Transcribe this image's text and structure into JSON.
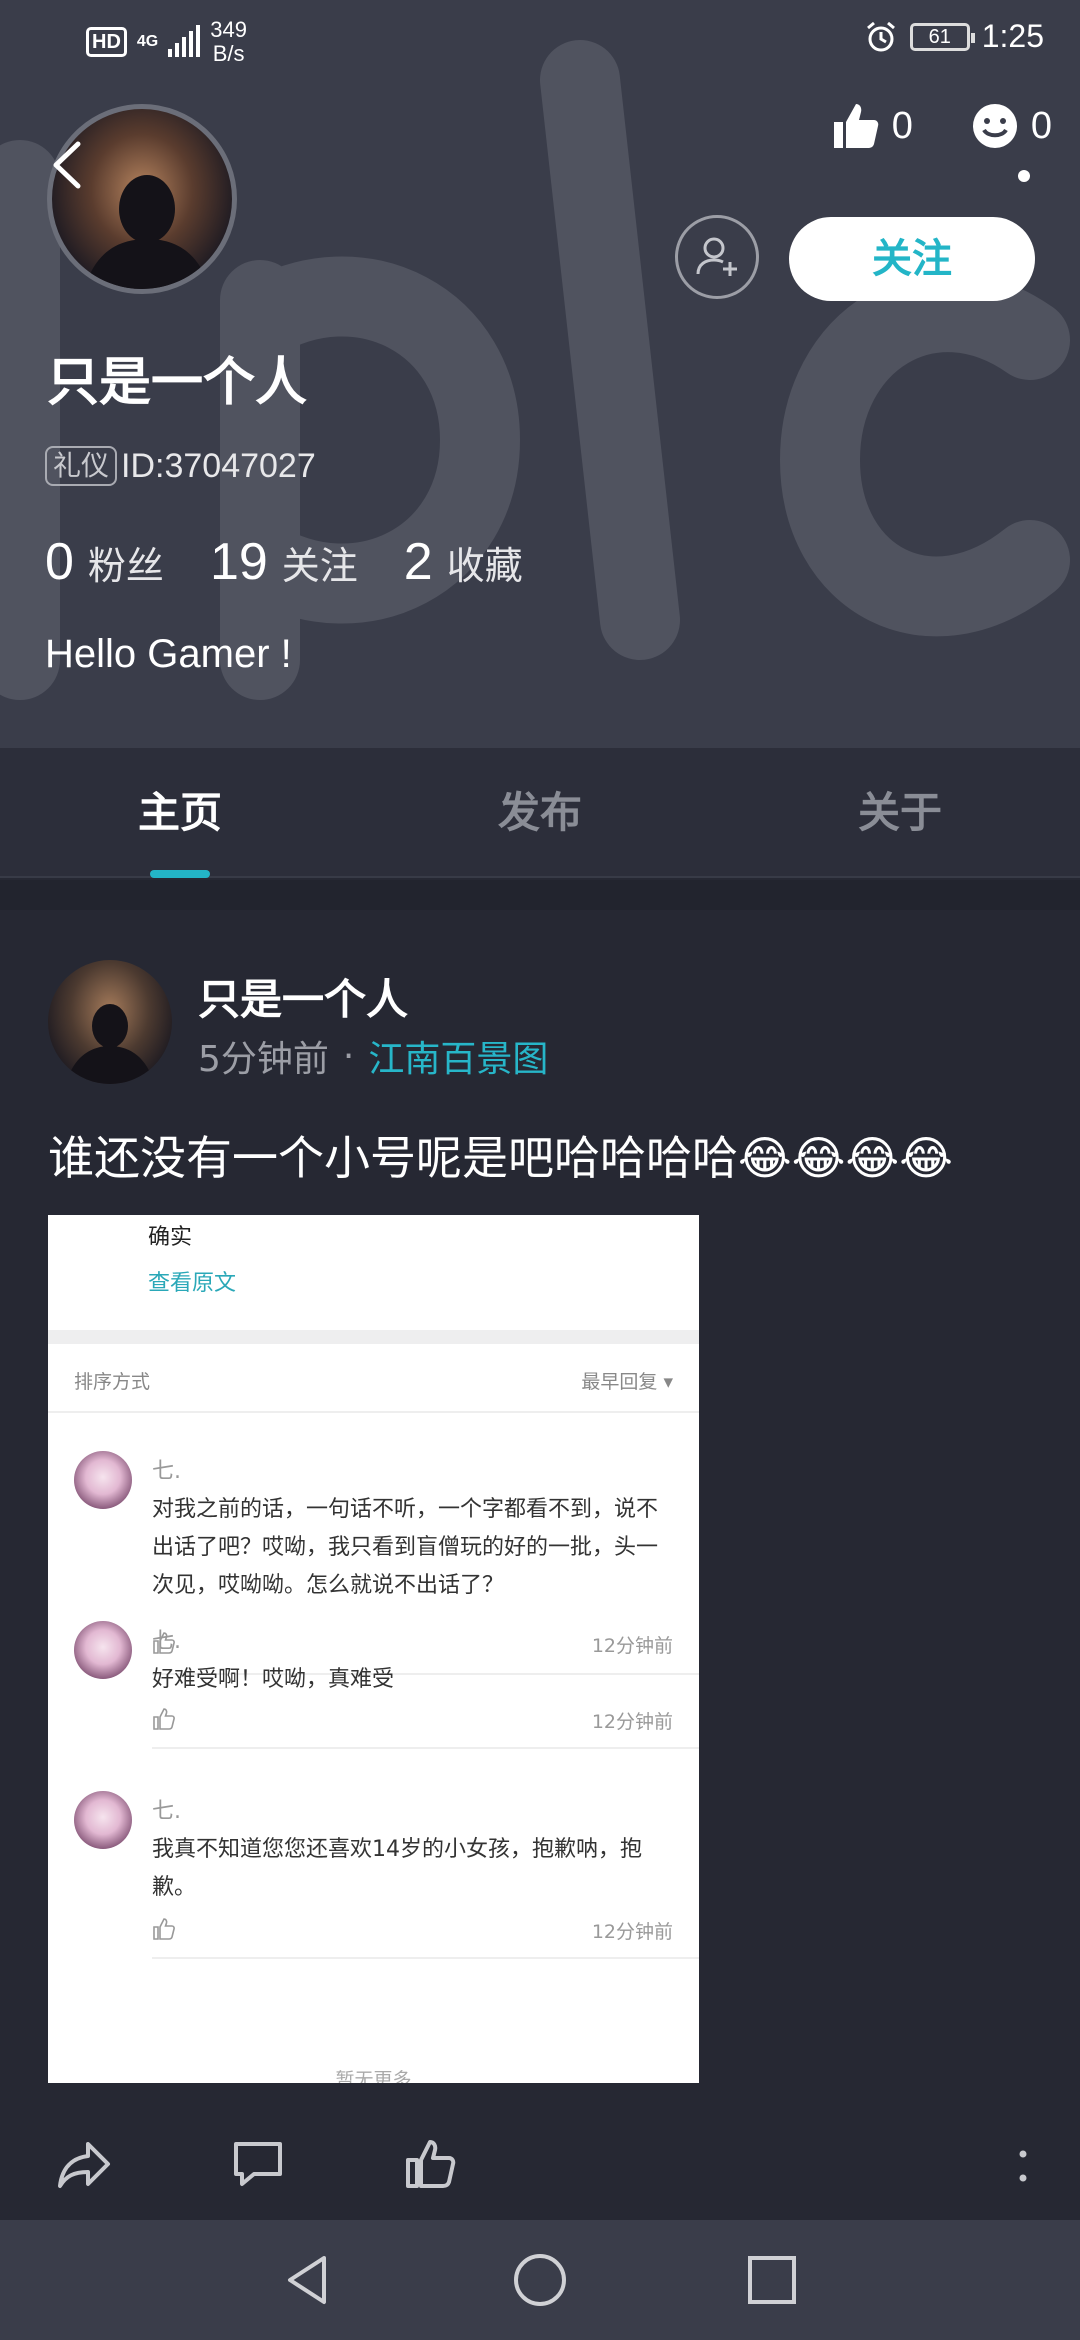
{
  "status_bar": {
    "hd": "HD",
    "network": "4G",
    "speed_value": "349",
    "speed_unit": "B/s",
    "battery": "61",
    "time": "1:25"
  },
  "profile": {
    "username": "只是一个人",
    "badge": "礼仪",
    "id_text": "ID:37047027",
    "likes_count": "0",
    "emoji_count": "0",
    "follow_label": "关注",
    "bio": "Hello Gamer !",
    "stats": [
      {
        "num": "0",
        "label": "粉丝"
      },
      {
        "num": "19",
        "label": "关注"
      },
      {
        "num": "2",
        "label": "收藏"
      }
    ]
  },
  "tabs": [
    {
      "label": "主页",
      "active": true
    },
    {
      "label": "发布",
      "active": false
    },
    {
      "label": "关于",
      "active": false
    }
  ],
  "post": {
    "author": "只是一个人",
    "time": "5分钟前",
    "separator": "·",
    "topic": "江南百景图",
    "text": "谁还没有一个小号呢是吧哈哈哈哈😂😂😂😂",
    "screenshot": {
      "top_text": "确实",
      "view_original": "查看原文",
      "sort_label": "排序方式",
      "sort_value": "最早回复",
      "comments": [
        {
          "name": "七.",
          "text": "对我之前的话，一句话不听，一个字都看不到，说不出话了吧？哎呦，我只看到盲僧玩的好的一批，头一次见，哎呦呦。怎么就说不出话了？",
          "time": "12分钟前"
        },
        {
          "name": "七.",
          "text": "好难受啊！哎呦，真难受",
          "time": "12分钟前"
        },
        {
          "name": "七.",
          "text": "我真不知道您您还喜欢14岁的小女孩，抱歉呐，抱歉。",
          "time": "12分钟前"
        }
      ],
      "more_text": "暂无更多"
    }
  },
  "colors": {
    "accent": "#23b5c7",
    "header_bg": "#3a3d4a",
    "page_bg": "#262833"
  }
}
